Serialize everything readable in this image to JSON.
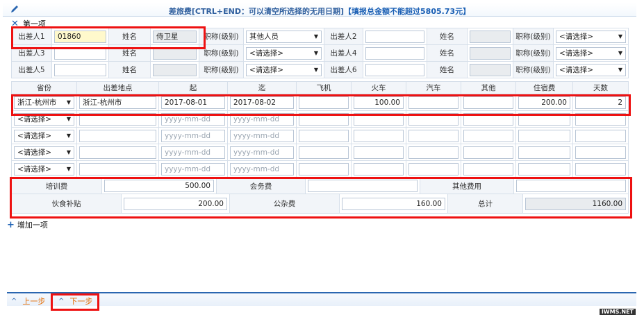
{
  "header": {
    "title": "差旅费[CTRL+END：可以清空所选择的无用日期]",
    "warning": "【填报总金额不能超过5805.73元】"
  },
  "section": {
    "label": "第一项",
    "add_label": "增加一项"
  },
  "persons": {
    "rows": [
      [
        {
          "label": "出差人1",
          "value": "01860",
          "name_label": "姓名",
          "name_value": "侍卫星",
          "title_label": "职称(级别)",
          "title_value": "其他人员"
        },
        {
          "label": "出差人2",
          "value": "",
          "name_label": "姓名",
          "name_value": "",
          "title_label": "职称(级别)",
          "title_value": "<请选择>"
        }
      ],
      [
        {
          "label": "出差人3",
          "value": "",
          "name_label": "姓名",
          "name_value": "",
          "title_label": "职称(级别)",
          "title_value": "<请选择>"
        },
        {
          "label": "出差人4",
          "value": "",
          "name_label": "姓名",
          "name_value": "",
          "title_label": "职称(级别)",
          "title_value": "<请选择>"
        }
      ],
      [
        {
          "label": "出差人5",
          "value": "",
          "name_label": "姓名",
          "name_value": "",
          "title_label": "职称(级别)",
          "title_value": "<请选择>"
        },
        {
          "label": "出差人6",
          "value": "",
          "name_label": "姓名",
          "name_value": "",
          "title_label": "职称(级别)",
          "title_value": "<请选择>"
        }
      ]
    ]
  },
  "trips": {
    "columns": [
      "省份",
      "出差地点",
      "起",
      "迄",
      "飞机",
      "火车",
      "汽车",
      "其他",
      "住宿费",
      "天数"
    ],
    "date_placeholder": "yyyy-mm-dd",
    "rows": [
      {
        "province": "浙江-杭州市",
        "place": "浙江-杭州市",
        "start": "2017-08-01",
        "end": "2017-08-02",
        "plane": "",
        "train": "100.00",
        "bus": "",
        "other": "",
        "lodging": "200.00",
        "days": "2"
      },
      {
        "province": "<请选择>",
        "place": "",
        "start": "",
        "end": "",
        "plane": "",
        "train": "",
        "bus": "",
        "other": "",
        "lodging": "",
        "days": ""
      },
      {
        "province": "<请选择>",
        "place": "",
        "start": "",
        "end": "",
        "plane": "",
        "train": "",
        "bus": "",
        "other": "",
        "lodging": "",
        "days": ""
      },
      {
        "province": "<请选择>",
        "place": "",
        "start": "",
        "end": "",
        "plane": "",
        "train": "",
        "bus": "",
        "other": "",
        "lodging": "",
        "days": ""
      },
      {
        "province": "<请选择>",
        "place": "",
        "start": "",
        "end": "",
        "plane": "",
        "train": "",
        "bus": "",
        "other": "",
        "lodging": "",
        "days": ""
      }
    ]
  },
  "fees": {
    "training_label": "培训费",
    "training_value": "500.00",
    "meeting_label": "会务费",
    "meeting_value": "",
    "other_label": "其他费用",
    "other_value": "",
    "meal_label": "伙食补贴",
    "meal_value": "200.00",
    "misc_label": "公杂费",
    "misc_value": "160.00",
    "total_label": "总计",
    "total_value": "1160.00"
  },
  "nav": {
    "prev_label": "上一步",
    "next_label": "下一步"
  },
  "watermark": "IWMS.NET",
  "colors": {
    "accent": "#2a66b0",
    "highlight": "#ee1111",
    "nav_text": "#e46b00"
  }
}
